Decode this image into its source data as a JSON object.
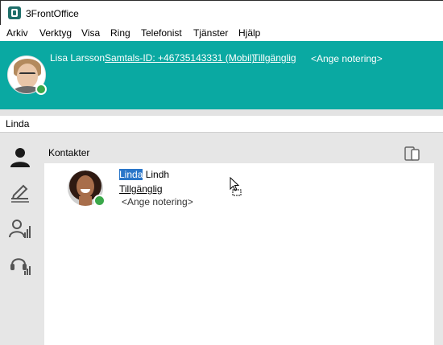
{
  "window": {
    "title": "3FrontOffice"
  },
  "menu": [
    "Arkiv",
    "Verktyg",
    "Visa",
    "Ring",
    "Telefonist",
    "Tjänster",
    "Hjälp"
  ],
  "header": {
    "user_name": "Lisa Larsson",
    "session_id": "Samtals-ID: +46735143331 (Mobil)",
    "status": "Tillgänglig",
    "note": "<Ange notering>",
    "status_color": "#3aa84a",
    "background_color": "#0aa9a2"
  },
  "search": {
    "value": "Linda"
  },
  "sidebar": {
    "icons": [
      "person-icon",
      "signature-pen-icon",
      "group-stats-icon",
      "headset-stats-icon"
    ]
  },
  "contacts_panel": {
    "title": "Kontakter",
    "device_icon": "devices-icon",
    "contacts": [
      {
        "first_name_match": "Linda",
        "rest_of_name": " Lindh",
        "status": "Tillgänglig",
        "note": "<Ange notering>",
        "status_color": "#3aa84a"
      }
    ]
  }
}
